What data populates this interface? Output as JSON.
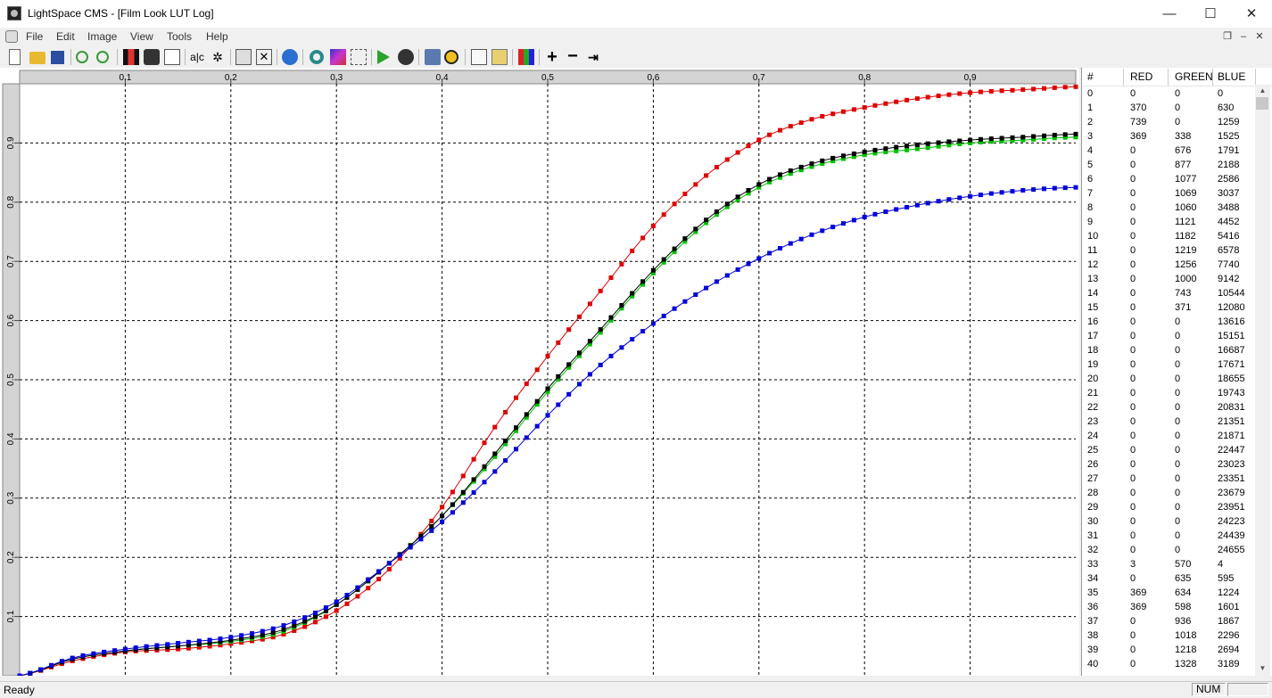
{
  "window": {
    "title": "LightSpace CMS - [Film Look LUT Log]",
    "minimize_glyph": "—",
    "maximize_glyph": "☐",
    "close_glyph": "✕"
  },
  "menu": {
    "items": [
      "File",
      "Edit",
      "Image",
      "View",
      "Tools",
      "Help"
    ],
    "mdi_minimize": "–",
    "mdi_restore": "❐",
    "mdi_close": "✕"
  },
  "toolbar": {
    "icons": [
      "new-file-icon",
      "open-folder-icon",
      "save-icon",
      "undo-icon",
      "redo-icon",
      "film-strip-icon",
      "cube-icon",
      "curve-icon",
      "abc-text-icon",
      "transform-icon",
      "edit-icon",
      "crop-icon",
      "help-icon",
      "target-icon",
      "palette-icon",
      "grid-icon",
      "play-icon",
      "dial-icon",
      "print-icon",
      "radiation-icon",
      "copy-icon",
      "convert-icon",
      "color-bars-icon",
      "plus-icon",
      "minus-icon",
      "export-icon"
    ]
  },
  "colors": {
    "red": "#e00000",
    "green": "#00c000",
    "blue": "#0000d8",
    "black": "#000000"
  },
  "chart_data": {
    "type": "line",
    "x_axis": {
      "range": [
        0,
        1
      ],
      "ticks": [
        "0.1",
        "0.2",
        "0.3",
        "0.4",
        "0.5",
        "0.6",
        "0.7",
        "0.8",
        "0.9"
      ]
    },
    "y_axis": {
      "range": [
        0,
        1
      ],
      "ticks": [
        "0.1",
        "0.2",
        "0.3",
        "0.4",
        "0.5",
        "0.6",
        "0.7",
        "0.8",
        "0.9"
      ]
    },
    "grid": true,
    "series": [
      {
        "color": "red",
        "x": [
          0,
          0.05,
          0.1,
          0.15,
          0.2,
          0.25,
          0.3,
          0.35,
          0.4,
          0.45,
          0.5,
          0.55,
          0.6,
          0.65,
          0.7,
          0.75,
          0.8,
          0.85,
          0.9,
          0.95,
          1.0
        ],
        "y": [
          0,
          0.025,
          0.04,
          0.045,
          0.054,
          0.07,
          0.11,
          0.18,
          0.285,
          0.42,
          0.54,
          0.65,
          0.76,
          0.845,
          0.905,
          0.94,
          0.96,
          0.975,
          0.985,
          0.99,
          0.995
        ]
      },
      {
        "color": "green",
        "x": [
          0,
          0.05,
          0.1,
          0.15,
          0.2,
          0.25,
          0.3,
          0.35,
          0.4,
          0.45,
          0.5,
          0.55,
          0.6,
          0.65,
          0.7,
          0.75,
          0.8,
          0.85,
          0.9,
          0.95,
          1.0
        ],
        "y": [
          0,
          0.028,
          0.042,
          0.05,
          0.058,
          0.075,
          0.12,
          0.19,
          0.27,
          0.37,
          0.48,
          0.58,
          0.68,
          0.765,
          0.825,
          0.86,
          0.88,
          0.89,
          0.9,
          0.905,
          0.91
        ]
      },
      {
        "color": "black",
        "x": [
          0,
          0.05,
          0.1,
          0.15,
          0.2,
          0.25,
          0.3,
          0.35,
          0.4,
          0.45,
          0.5,
          0.55,
          0.6,
          0.65,
          0.7,
          0.75,
          0.8,
          0.85,
          0.9,
          0.95,
          1.0
        ],
        "y": [
          0,
          0.028,
          0.042,
          0.05,
          0.06,
          0.078,
          0.12,
          0.19,
          0.27,
          0.375,
          0.485,
          0.585,
          0.685,
          0.77,
          0.83,
          0.865,
          0.885,
          0.897,
          0.905,
          0.91,
          0.915
        ]
      },
      {
        "color": "blue",
        "x": [
          0,
          0.05,
          0.1,
          0.15,
          0.2,
          0.25,
          0.3,
          0.35,
          0.4,
          0.45,
          0.5,
          0.55,
          0.6,
          0.65,
          0.7,
          0.75,
          0.8,
          0.85,
          0.9,
          0.95,
          1.0
        ],
        "y": [
          0,
          0.03,
          0.045,
          0.055,
          0.065,
          0.085,
          0.125,
          0.19,
          0.26,
          0.345,
          0.44,
          0.525,
          0.595,
          0.655,
          0.705,
          0.745,
          0.775,
          0.795,
          0.81,
          0.82,
          0.825
        ]
      }
    ]
  },
  "table": {
    "headers": [
      "#",
      "RED",
      "GREEN",
      "BLUE"
    ],
    "rows": [
      [
        "0",
        "0",
        "0",
        "0"
      ],
      [
        "1",
        "370",
        "0",
        "630"
      ],
      [
        "2",
        "739",
        "0",
        "1259"
      ],
      [
        "3",
        "369",
        "338",
        "1525"
      ],
      [
        "4",
        "0",
        "676",
        "1791"
      ],
      [
        "5",
        "0",
        "877",
        "2188"
      ],
      [
        "6",
        "0",
        "1077",
        "2586"
      ],
      [
        "7",
        "0",
        "1069",
        "3037"
      ],
      [
        "8",
        "0",
        "1060",
        "3488"
      ],
      [
        "9",
        "0",
        "1121",
        "4452"
      ],
      [
        "10",
        "0",
        "1182",
        "5416"
      ],
      [
        "11",
        "0",
        "1219",
        "6578"
      ],
      [
        "12",
        "0",
        "1256",
        "7740"
      ],
      [
        "13",
        "0",
        "1000",
        "9142"
      ],
      [
        "14",
        "0",
        "743",
        "10544"
      ],
      [
        "15",
        "0",
        "371",
        "12080"
      ],
      [
        "16",
        "0",
        "0",
        "13616"
      ],
      [
        "17",
        "0",
        "0",
        "15151"
      ],
      [
        "18",
        "0",
        "0",
        "16687"
      ],
      [
        "19",
        "0",
        "0",
        "17671"
      ],
      [
        "20",
        "0",
        "0",
        "18655"
      ],
      [
        "21",
        "0",
        "0",
        "19743"
      ],
      [
        "22",
        "0",
        "0",
        "20831"
      ],
      [
        "23",
        "0",
        "0",
        "21351"
      ],
      [
        "24",
        "0",
        "0",
        "21871"
      ],
      [
        "25",
        "0",
        "0",
        "22447"
      ],
      [
        "26",
        "0",
        "0",
        "23023"
      ],
      [
        "27",
        "0",
        "0",
        "23351"
      ],
      [
        "28",
        "0",
        "0",
        "23679"
      ],
      [
        "29",
        "0",
        "0",
        "23951"
      ],
      [
        "30",
        "0",
        "0",
        "24223"
      ],
      [
        "31",
        "0",
        "0",
        "24439"
      ],
      [
        "32",
        "0",
        "0",
        "24655"
      ],
      [
        "33",
        "3",
        "570",
        "4"
      ],
      [
        "34",
        "0",
        "635",
        "595"
      ],
      [
        "35",
        "369",
        "634",
        "1224"
      ],
      [
        "36",
        "369",
        "598",
        "1601"
      ],
      [
        "37",
        "0",
        "936",
        "1867"
      ],
      [
        "38",
        "0",
        "1018",
        "2296"
      ],
      [
        "39",
        "0",
        "1218",
        "2694"
      ],
      [
        "40",
        "0",
        "1328",
        "3189"
      ]
    ]
  },
  "scrollbar": {
    "up_arrow": "▲",
    "down_arrow": "▼"
  },
  "status": {
    "text": "Ready",
    "num": "NUM"
  }
}
